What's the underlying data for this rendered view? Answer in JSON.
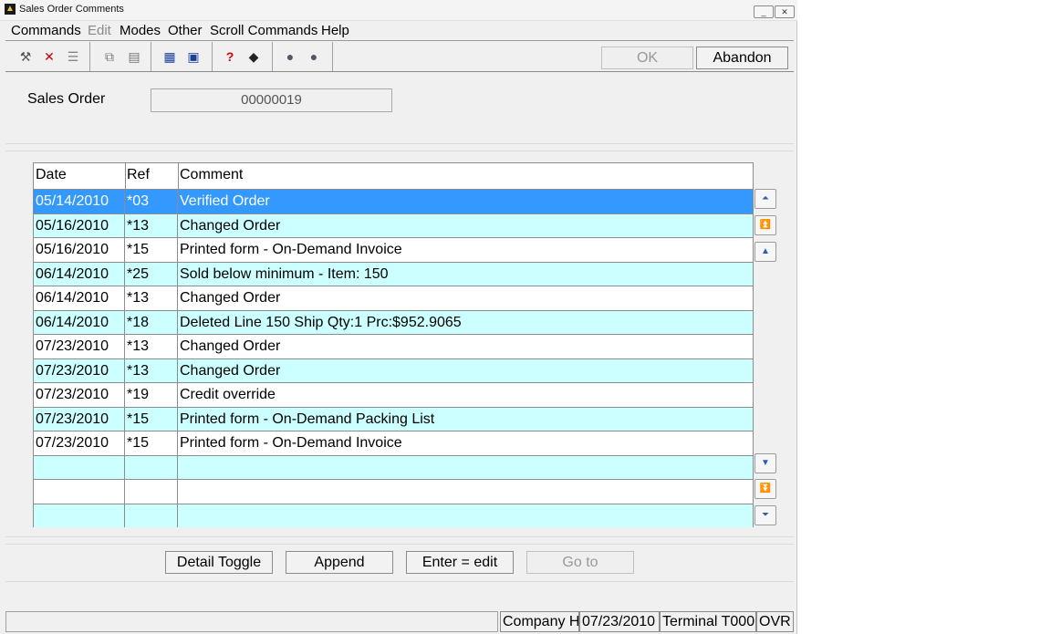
{
  "window": {
    "title": "Sales Order Comments",
    "minimize_glyph": "_",
    "close_glyph": "✕"
  },
  "menu": [
    "Commands",
    "Edit",
    "Modes",
    "Other",
    "Scroll Commands",
    "Help"
  ],
  "toolbar": {
    "tools": [
      "hammer-icon",
      "delete-icon",
      "list-icon",
      "copy-icon",
      "paste-icon",
      "calculator-icon",
      "form-icon",
      "help-icon",
      "book-icon",
      "globe-icon",
      "globe2-icon"
    ],
    "ok_label": "OK",
    "abandon_label": "Abandon"
  },
  "sales_order": {
    "label": "Sales Order",
    "value": "00000019"
  },
  "grid": {
    "columns": [
      "Date",
      "Ref",
      "Comment"
    ],
    "rows": [
      {
        "date": "05/14/2010",
        "ref": "*03",
        "comment": "Verified Order"
      },
      {
        "date": "05/16/2010",
        "ref": "*13",
        "comment": "Changed Order"
      },
      {
        "date": "05/16/2010",
        "ref": "*15",
        "comment": "Printed form - On-Demand Invoice"
      },
      {
        "date": "06/14/2010",
        "ref": "*25",
        "comment": "Sold below minimum - Item: 150"
      },
      {
        "date": "06/14/2010",
        "ref": "*13",
        "comment": "Changed Order"
      },
      {
        "date": "06/14/2010",
        "ref": "*18",
        "comment": "Deleted Line  150 Ship Qty:1 Prc:$952.9065"
      },
      {
        "date": "07/23/2010",
        "ref": "*13",
        "comment": "Changed Order"
      },
      {
        "date": "07/23/2010",
        "ref": "*13",
        "comment": "Changed Order"
      },
      {
        "date": "07/23/2010",
        "ref": "*19",
        "comment": "Credit override"
      },
      {
        "date": "07/23/2010",
        "ref": "*15",
        "comment": "Printed form - On-Demand Packing List"
      },
      {
        "date": "07/23/2010",
        "ref": "*15",
        "comment": "Printed form - On-Demand Invoice"
      },
      {
        "date": "",
        "ref": "",
        "comment": ""
      },
      {
        "date": "",
        "ref": "",
        "comment": ""
      },
      {
        "date": "",
        "ref": "",
        "comment": ""
      }
    ],
    "selected_index": 0
  },
  "scroll_buttons": [
    "scroll-top",
    "page-up",
    "line-up",
    "line-down",
    "page-down",
    "scroll-bottom"
  ],
  "buttons": {
    "detail_toggle": "Detail Toggle",
    "append": "Append",
    "enter_edit": "Enter = edit",
    "go_to": "Go to"
  },
  "status": {
    "company": "Company H",
    "date": "07/23/2010",
    "terminal": "Terminal T000",
    "mode": "OVR"
  },
  "colors": {
    "selected_row": "#3399ff",
    "alt_row": "#ccffff",
    "row": "#ffffff"
  }
}
